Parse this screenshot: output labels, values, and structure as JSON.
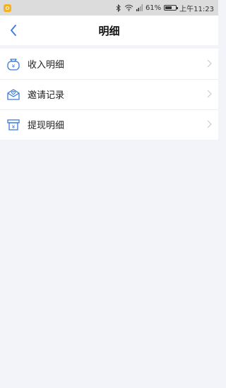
{
  "status_bar": {
    "battery_percent": "61%",
    "battery_level": 0.61,
    "time": "上午11:23",
    "icons": [
      "app-notification-icon",
      "bluetooth-icon",
      "wifi-icon",
      "signal-icon",
      "battery-icon"
    ]
  },
  "header": {
    "title": "明细",
    "back_icon": "chevron-left-icon"
  },
  "menu": {
    "items": [
      {
        "label": "收入明细",
        "icon": "income-bag-icon"
      },
      {
        "label": "邀请记录",
        "icon": "invite-envelope-icon"
      },
      {
        "label": "提现明细",
        "icon": "withdraw-icon"
      }
    ]
  },
  "colors": {
    "accent": "#3b7bd8",
    "page_background": "#f3f4fa",
    "status_bar": "#dcdcdc",
    "chevron": "#cccccc"
  }
}
